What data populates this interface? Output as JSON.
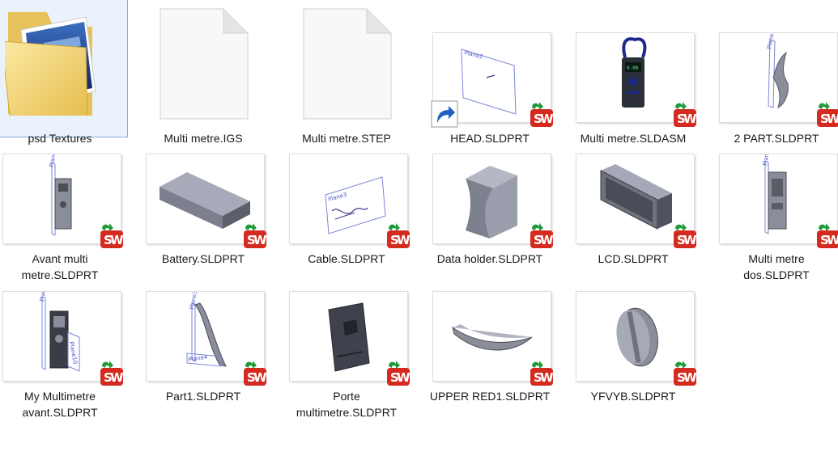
{
  "items": [
    {
      "label": "psd Textures",
      "kind": "folder",
      "selected": true
    },
    {
      "label": "Multi metre.IGS",
      "kind": "document"
    },
    {
      "label": "Multi metre.STEP",
      "kind": "document"
    },
    {
      "label": "HEAD.SLDPRT",
      "kind": "solidworks-part",
      "shortcut": true
    },
    {
      "label": "Multi metre.SLDASM",
      "kind": "solidworks-assembly"
    },
    {
      "label": "2 PART.SLDPRT",
      "kind": "solidworks-part"
    },
    {
      "label": "Avant multi\nmetre.SLDPRT",
      "kind": "solidworks-part"
    },
    {
      "label": "Battery.SLDPRT",
      "kind": "solidworks-part"
    },
    {
      "label": "Cable.SLDPRT",
      "kind": "solidworks-part"
    },
    {
      "label": "Data holder.SLDPRT",
      "kind": "solidworks-part"
    },
    {
      "label": "LCD.SLDPRT",
      "kind": "solidworks-part"
    },
    {
      "label": "Multi metre\ndos.SLDPRT",
      "kind": "solidworks-part"
    },
    {
      "label": "My Multimetre\navant.SLDPRT",
      "kind": "solidworks-part"
    },
    {
      "label": "Part1.SLDPRT",
      "kind": "solidworks-part"
    },
    {
      "label": "Porte\nmultimetre.SLDPRT",
      "kind": "solidworks-part"
    },
    {
      "label": "UPPER  RED1.SLDPRT",
      "kind": "solidworks-part"
    },
    {
      "label": "YFVYB.SLDPRT",
      "kind": "solidworks-part"
    }
  ],
  "plane_labels": {
    "head": "Plane2",
    "two_part": "Plane3",
    "avant": "Plane11",
    "cable": "Plane3",
    "dos": "Plane8",
    "my_multimetre_top": "Plane5",
    "my_multimetre_side": "Plane10",
    "part1_top": "Plane3",
    "part1_bottom": "Plane4"
  },
  "lcd_text": "0.00",
  "colors": {
    "selection_bg": "#eaf3fd",
    "selection_border": "#84acdd",
    "part_gray": "#8a8d9a",
    "plane_blue": "#4b55c8",
    "solidworks_red": "#d42a1f"
  }
}
